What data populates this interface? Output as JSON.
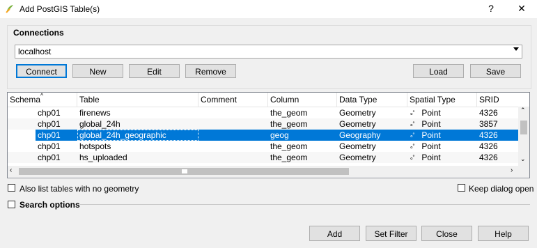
{
  "window": {
    "title": "Add PostGIS Table(s)",
    "help_glyph": "?",
    "close_glyph": "✕"
  },
  "connections": {
    "label": "Connections",
    "selected": "localhost",
    "buttons": {
      "connect": "Connect",
      "new": "New",
      "edit": "Edit",
      "remove": "Remove",
      "load": "Load",
      "save": "Save"
    }
  },
  "table": {
    "columns": [
      "Schema",
      "Table",
      "Comment",
      "Column",
      "Data Type",
      "Spatial Type",
      "SRID"
    ],
    "rows": [
      {
        "schema": "chp01",
        "table": "firenews",
        "comment": "",
        "column": "the_geom",
        "data_type": "Geometry",
        "spatial_type": "Point",
        "srid": "4326",
        "selected": false
      },
      {
        "schema": "chp01",
        "table": "global_24h",
        "comment": "",
        "column": "the_geom",
        "data_type": "Geometry",
        "spatial_type": "Point",
        "srid": "3857",
        "selected": false
      },
      {
        "schema": "chp01",
        "table": "global_24h_geographic",
        "comment": "",
        "column": "geog",
        "data_type": "Geography",
        "spatial_type": "Point",
        "srid": "4326",
        "selected": true
      },
      {
        "schema": "chp01",
        "table": "hotspots",
        "comment": "",
        "column": "the_geom",
        "data_type": "Geometry",
        "spatial_type": "Point",
        "srid": "4326",
        "selected": false
      },
      {
        "schema": "chp01",
        "table": "hs_uploaded",
        "comment": "",
        "column": "the_geom",
        "data_type": "Geometry",
        "spatial_type": "Point",
        "srid": "4326",
        "selected": false
      }
    ]
  },
  "options": {
    "no_geometry": "Also list tables with no geometry",
    "keep_dialog": "Keep dialog open",
    "search_options": "Search options"
  },
  "footer": {
    "add": "Add",
    "set_filter": "Set Filter",
    "close": "Close",
    "help": "Help"
  },
  "colors": {
    "selection": "#0078d7",
    "window_bg": "#f0f0f0"
  }
}
